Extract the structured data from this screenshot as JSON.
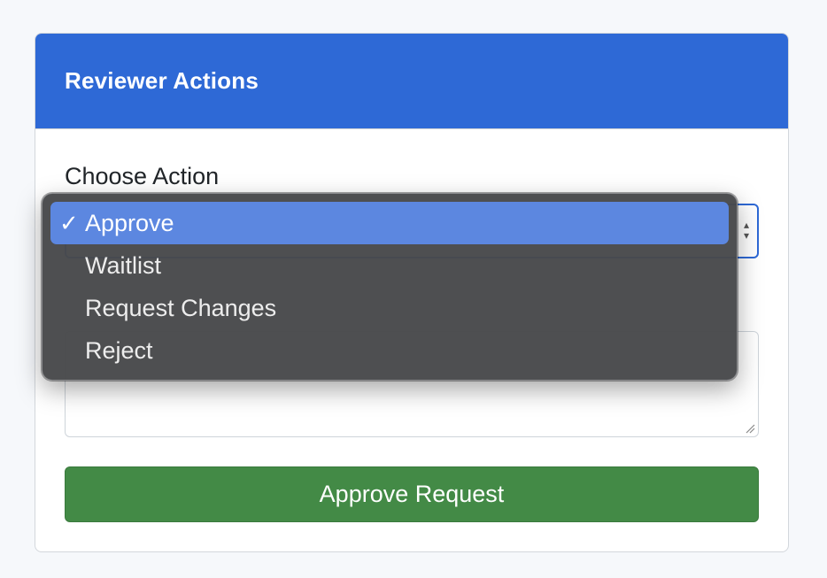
{
  "card": {
    "title": "Reviewer Actions"
  },
  "action_field": {
    "label": "Choose Action",
    "selected": "Approve"
  },
  "notes_field": {
    "label": "",
    "value": ""
  },
  "submit": {
    "label": "Approve Request"
  },
  "dropdown": {
    "options": [
      {
        "label": "Approve",
        "selected": true
      },
      {
        "label": "Waitlist",
        "selected": false
      },
      {
        "label": "Request Changes",
        "selected": false
      },
      {
        "label": "Reject",
        "selected": false
      }
    ],
    "check_icon": "checkmark-icon"
  },
  "colors": {
    "header": "#2e69d6",
    "submit": "#438a46",
    "dropdown_bg": "#48494b",
    "selected_option": "#5c87e0"
  }
}
